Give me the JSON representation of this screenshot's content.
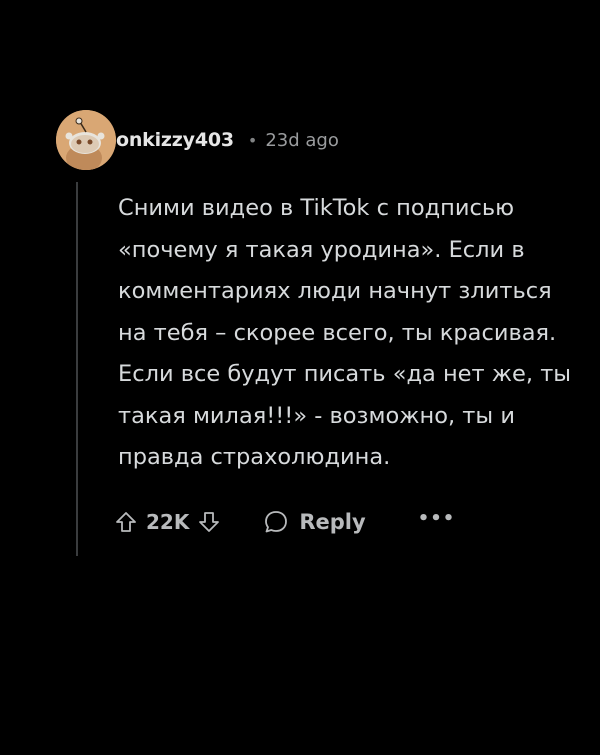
{
  "comment": {
    "username": "onkizzy403",
    "separator": "•",
    "time_ago": "23d ago",
    "body": "Сними видео в TikTok с подписью\n«почему я такая уродина». Если в\nкомментариях люди начнут злиться\nна тебя – скорее всего, ты красивая.\nЕсли все будут писать «да нет же, ты\nтакая милая!!!» - возможно, ты и\nправда страхолюдина.",
    "avatar_icon": "snoo-avatar-icon",
    "avatar_color": "#d9a774"
  },
  "actions": {
    "upvote_icon": "upvote-arrow-icon",
    "score": "22K",
    "downvote_icon": "downvote-arrow-icon",
    "reply_icon": "speech-bubble-icon",
    "reply_label": "Reply",
    "more_label": "•••"
  }
}
